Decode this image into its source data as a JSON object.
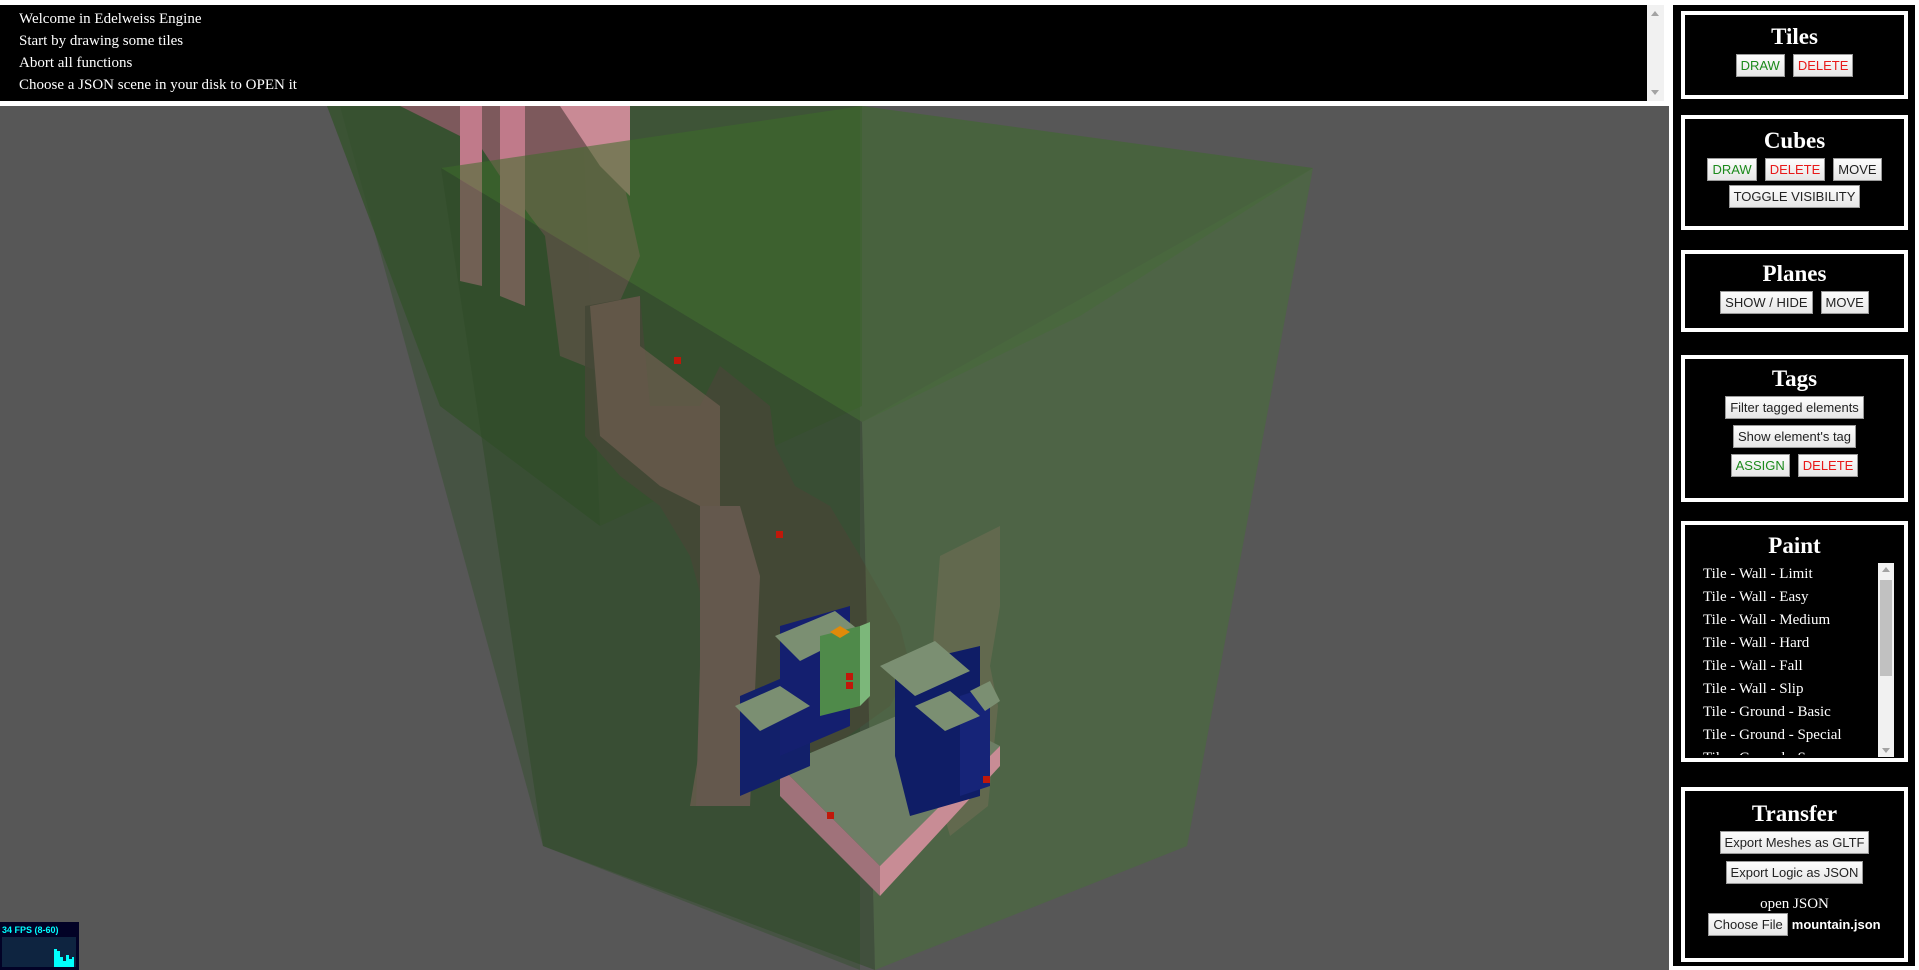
{
  "console": {
    "lines": [
      "Welcome in Edelweiss Engine",
      "Start by drawing some tiles",
      "Abort all functions",
      "Choose a JSON scene in your disk to OPEN it"
    ]
  },
  "fps": {
    "label": "34 FPS (8-60)",
    "color": "#00ffff"
  },
  "panel": {
    "tiles": {
      "title": "Tiles",
      "draw": "DRAW",
      "delete": "DELETE"
    },
    "cubes": {
      "title": "Cubes",
      "draw": "DRAW",
      "delete": "DELETE",
      "move": "MOVE",
      "toggle": "TOGGLE VISIBILITY"
    },
    "planes": {
      "title": "Planes",
      "showhide": "SHOW / HIDE",
      "move": "MOVE"
    },
    "tags": {
      "title": "Tags",
      "filter": "Filter tagged elements",
      "show": "Show element's tag",
      "assign": "ASSIGN",
      "delete": "DELETE"
    },
    "paint": {
      "title": "Paint",
      "items": [
        "Tile - Wall - Limit",
        "Tile - Wall - Easy",
        "Tile - Wall - Medium",
        "Tile - Wall - Hard",
        "Tile - Wall - Fall",
        "Tile - Wall - Slip",
        "Tile - Ground - Basic",
        "Tile - Ground - Special",
        "Tile - Ground - S"
      ]
    },
    "transfer": {
      "title": "Transfer",
      "export_gltf": "Export Meshes as GLTF",
      "export_json": "Export Logic as JSON",
      "open_label": "open JSON",
      "choose_file": "Choose File",
      "file_name": "mountain.json"
    }
  },
  "colors": {
    "add": "#1b8a1b",
    "remove": "#e81919",
    "viewport_bg": "#575757"
  }
}
